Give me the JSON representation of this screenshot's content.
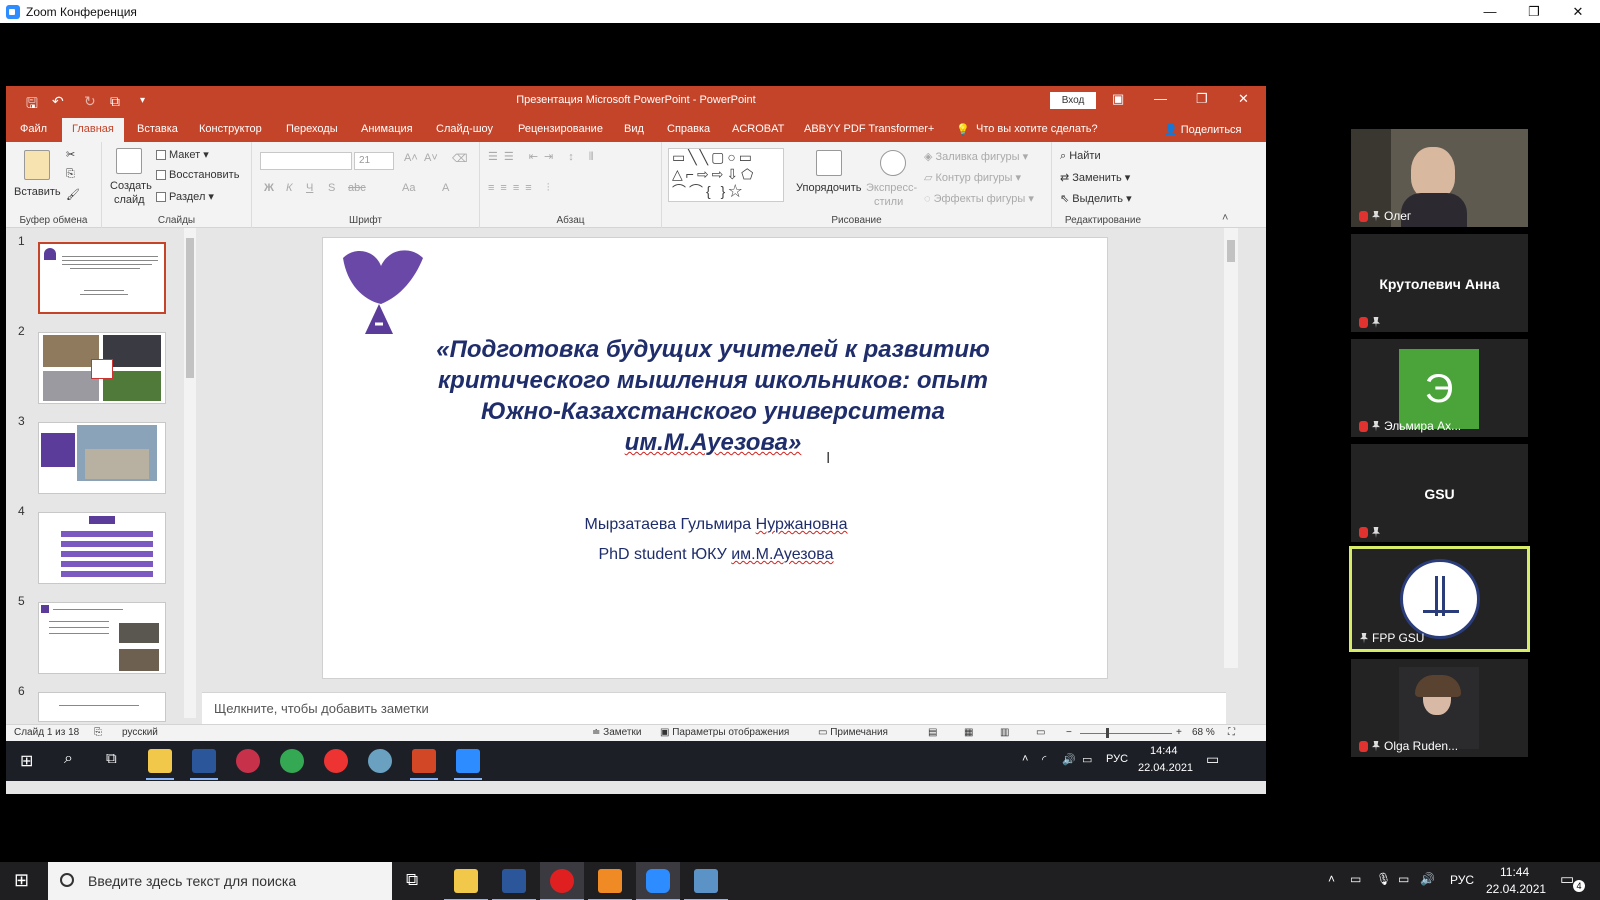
{
  "zoom": {
    "window_title": "Zoom Конференция",
    "controls": [
      "—",
      "❐",
      "✕"
    ]
  },
  "ppt": {
    "doc_title": "Презентация Microsoft PowerPoint - PowerPoint",
    "login": "Вход",
    "tabs": [
      "Файл",
      "Главная",
      "Вставка",
      "Конструктор",
      "Переходы",
      "Анимация",
      "Слайд-шоу",
      "Рецензирование",
      "Вид",
      "Справка",
      "ACROBAT",
      "ABBYY PDF Transformer+",
      "Что вы хотите сделать?"
    ],
    "share": "Поделиться",
    "ribbon": {
      "clipboard": {
        "paste": "Вставить",
        "label": "Буфер обмена"
      },
      "slides": {
        "new": "Создать",
        "new2": "слайд",
        "layout": "Макет",
        "reset": "Восстановить",
        "section": "Раздел",
        "label": "Слайды"
      },
      "font": {
        "size": "21",
        "label": "Шрифт",
        "styles": [
          "Ж",
          "К",
          "Ч",
          "S",
          "abc",
          "Aa",
          "A"
        ]
      },
      "paragraph": {
        "label": "Абзац"
      },
      "drawing": {
        "arrange": "Упорядочить",
        "express": "Экспресс-",
        "express2": "стили",
        "fill": "Заливка фигуры",
        "outline": "Контур фигуры",
        "effects": "Эффекты фигуры",
        "label": "Рисование"
      },
      "editing": {
        "find": "Найти",
        "replace": "Заменить",
        "select": "Выделить",
        "label": "Редактирование"
      }
    },
    "thumbs": [
      "1",
      "2",
      "3",
      "4",
      "5",
      "6"
    ],
    "slide": {
      "title": "«Подготовка будущих учителей к развитию критического мышления школьников: опыт Южно-Казахстанского университета",
      "title_last_plain": "",
      "title_last_squig": "им.М.Ауезова»",
      "author": "Мырзатаева Гульмира Нуржановна",
      "author_plain": "Мырзатаева Гульмира ",
      "author_squig": "Нуржановна",
      "affil_plain": "PhD student  ЮКУ ",
      "affil_squig": "им.М.Ауезова"
    },
    "notes_placeholder": "Щелкните, чтобы добавить заметки",
    "status": {
      "slide": "Слайд 1 из 18",
      "lang": "русский",
      "notes": "Заметки",
      "display": "Параметры отображения",
      "comments": "Примечания",
      "zoom": "68 %"
    },
    "inner_tray": {
      "lang": "РУС",
      "time": "14:44",
      "date": "22.04.2021"
    }
  },
  "participants": [
    {
      "name": "Олег",
      "type": "video"
    },
    {
      "name": "Крутолевич Анна",
      "type": "text"
    },
    {
      "name": "Эльмира Ах...",
      "type": "avatar",
      "letter": "Э",
      "color": "#4aa43a"
    },
    {
      "name": "GSU",
      "type": "text"
    },
    {
      "name": "FPP GSU",
      "type": "logo",
      "active": true
    },
    {
      "name": "Olga Ruden...",
      "type": "video"
    }
  ],
  "taskbar": {
    "search_placeholder": "Введите здесь текст для поиска",
    "lang": "РУС",
    "time": "11:44",
    "date": "22.04.2021",
    "notifications": "4"
  }
}
